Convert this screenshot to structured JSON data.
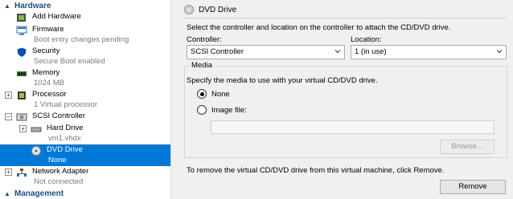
{
  "tree": {
    "hardware_header": "Hardware",
    "management_header": "Management",
    "items": [
      {
        "label": "Add Hardware",
        "sub": ""
      },
      {
        "label": "Firmware",
        "sub": "Boot entry changes pending"
      },
      {
        "label": "Security",
        "sub": "Secure Boot enabled"
      },
      {
        "label": "Memory",
        "sub": "1024 MB"
      },
      {
        "label": "Processor",
        "sub": "1 Virtual processor"
      },
      {
        "label": "SCSI Controller",
        "sub": ""
      },
      {
        "label": "Hard Drive",
        "sub": "vm1.vhdx"
      },
      {
        "label": "DVD Drive",
        "sub": "None"
      },
      {
        "label": "Network Adapter",
        "sub": "Not connected"
      }
    ],
    "expanders": {
      "plus": "+",
      "minus": "−"
    }
  },
  "detail": {
    "title": "DVD Drive",
    "instruction": "Select the controller and location on the controller to attach the CD/DVD drive.",
    "controller_label": "Controller:",
    "controller_value": "SCSI Controller",
    "location_label": "Location:",
    "location_value": "1 (in use)",
    "media": {
      "title": "Media",
      "prompt": "Specify the media to use with your virtual CD/DVD drive.",
      "option_none": "None",
      "option_image": "Image file:",
      "selected": "None",
      "image_path": "",
      "browse_label": "Browse..."
    },
    "remove_text": "To remove the virtual CD/DVD drive from this virtual machine, click Remove.",
    "remove_label": "Remove"
  },
  "colors": {
    "selection": "#0078d7",
    "header_text": "#1e4e86",
    "pane_bg": "#f0f0f0"
  },
  "icons": [
    "chevron-up-icon",
    "add-hardware-icon",
    "firmware-icon",
    "shield-icon",
    "memory-chip-icon",
    "processor-icon",
    "scsi-controller-icon",
    "hard-drive-icon",
    "dvd-disc-icon",
    "network-adapter-icon",
    "chevron-down-icon"
  ]
}
